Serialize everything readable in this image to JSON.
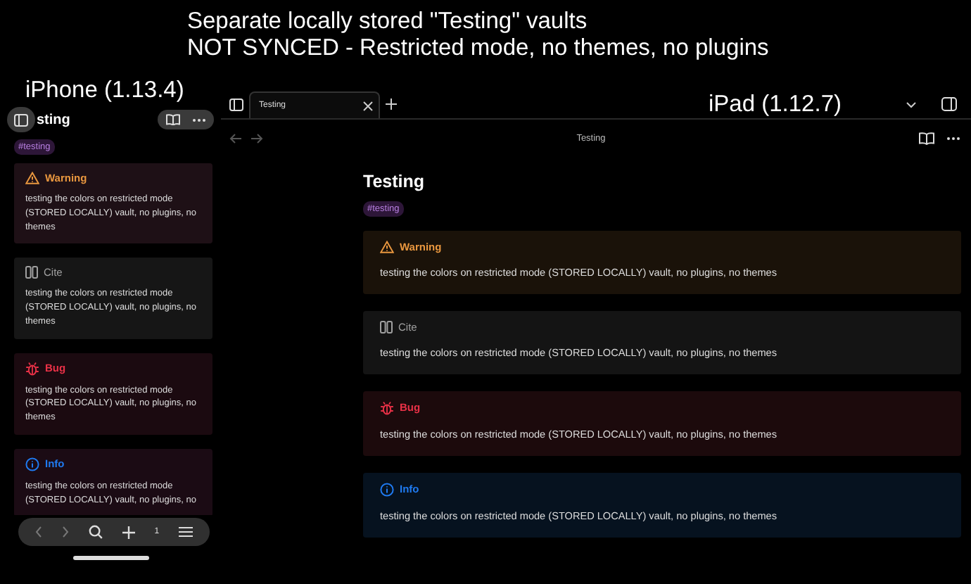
{
  "caption": [
    "Separate locally stored \"Testing\" vaults",
    "NOT SYNCED - Restricted mode, no themes, no plugins"
  ],
  "iphone": {
    "label": "iPhone (1.13.4)",
    "title": "sting",
    "tag": "#testing",
    "tab_count": "1",
    "callouts": [
      {
        "kind": "warning",
        "title": "Warning",
        "color": "#e9973f",
        "body": "testing the colors on restricted mode (STORED LOCALLY) vault, no plugins, no themes"
      },
      {
        "kind": "cite",
        "title": "Cite",
        "color": "#a0a0a0",
        "body": "testing the colors on restricted mode (STORED LOCALLY) vault, no plugins, no themes"
      },
      {
        "kind": "bug",
        "title": "Bug",
        "color": "#e93147",
        "body": "testing the colors on restricted mode (STORED LOCALLY) vault, no plugins, no themes"
      },
      {
        "kind": "info",
        "title": "Info",
        "color": "#1f7af0",
        "body": "testing the colors on restricted mode (STORED LOCALLY) vault, no plugins, no"
      }
    ]
  },
  "ipad": {
    "label": "iPad (1.12.7)",
    "tabs": [
      {
        "label": "Testing",
        "selected": true
      }
    ],
    "header_title": "Testing",
    "title": "Testing",
    "tag": "#testing",
    "callouts": [
      {
        "kind": "warning",
        "title": "Warning",
        "color": "#e9973f",
        "body": "testing the colors on restricted mode (STORED LOCALLY) vault, no plugins, no themes"
      },
      {
        "kind": "cite",
        "title": "Cite",
        "color": "#a0a0a0",
        "body": "testing the colors on restricted mode (STORED LOCALLY) vault, no plugins, no themes"
      },
      {
        "kind": "bug",
        "title": "Bug",
        "color": "#e93147",
        "body": "testing the colors on restricted mode (STORED LOCALLY) vault, no plugins, no themes"
      },
      {
        "kind": "info",
        "title": "Info",
        "color": "#1f7af0",
        "body": "testing the colors on restricted mode (STORED LOCALLY) vault, no plugins, no themes"
      }
    ]
  }
}
